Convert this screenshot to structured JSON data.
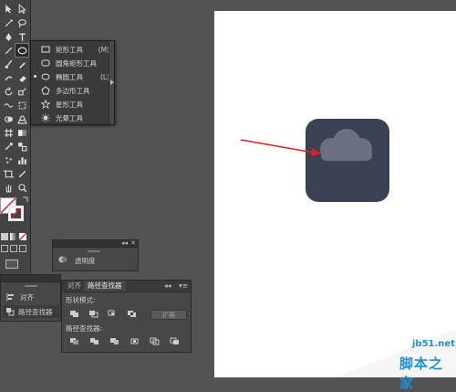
{
  "flyout": {
    "items": [
      {
        "label": "矩形工具",
        "key": "(M)",
        "icon": "rectangle-icon"
      },
      {
        "label": "圆角矩形工具",
        "key": "",
        "icon": "rounded-rectangle-icon"
      },
      {
        "label": "椭圆工具",
        "key": "(L)",
        "icon": "ellipse-icon",
        "selected": true
      },
      {
        "label": "多边形工具",
        "key": "",
        "icon": "polygon-icon"
      },
      {
        "label": "星形工具",
        "key": "",
        "icon": "star-icon"
      },
      {
        "label": "光晕工具",
        "key": "",
        "icon": "flare-icon"
      }
    ]
  },
  "transparency_panel": {
    "label": "透明度",
    "collapse": "◂◂",
    "close": "✕"
  },
  "align_panel": {
    "tab": "对齐",
    "items": [
      {
        "label": "对齐",
        "icon": "align-icon"
      },
      {
        "label": "路径查找器",
        "icon": "pathfinder-icon"
      }
    ]
  },
  "pathfinder_panel": {
    "tabs": [
      "对齐",
      "路径查找器"
    ],
    "shape_modes_label": "形状模式:",
    "expand_label": "扩展",
    "pathfinders_label": "路径查找器:",
    "collapse": "◂◂",
    "menu": "▾≡"
  },
  "watermark": {
    "site": "jb51.net",
    "name": "脚本之家"
  },
  "colors": {
    "canvas_bg": "#535353",
    "artboard": "#ffffff",
    "icon_bg": "#3b4254",
    "cloud": "#6a7183",
    "arrow": "#e0201c"
  }
}
